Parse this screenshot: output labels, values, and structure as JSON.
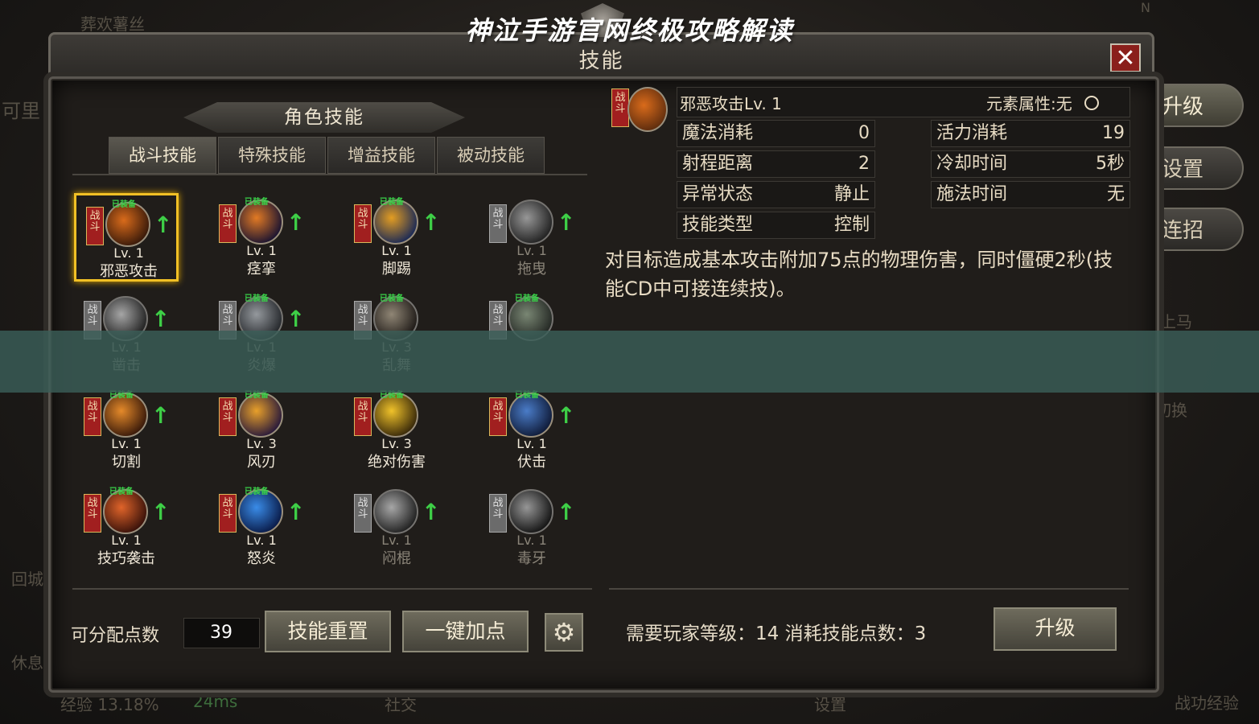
{
  "background": {
    "top_left": "葬欢薯丝",
    "left_frag": "可里",
    "left_mid_1": "回城",
    "left_mid_2": "休息",
    "bottom_left": "经验 13.18%",
    "bottom_ping": "24ms",
    "bottom_center": "社交",
    "bottom_settings": "设置",
    "bottom_right": "战功经验",
    "right_mount": "上马",
    "right_switch": "切换",
    "top_right": "N"
  },
  "side_buttons": [
    {
      "label": "升级"
    },
    {
      "label": "设置"
    },
    {
      "label": "连招"
    }
  ],
  "window": {
    "title": "技能",
    "close_icon": "✕"
  },
  "section_title": "角色技能",
  "tabs": [
    {
      "label": "战斗技能",
      "active": true
    },
    {
      "label": "特殊技能",
      "active": false
    },
    {
      "label": "增益技能",
      "active": false
    },
    {
      "label": "被动技能",
      "active": false
    }
  ],
  "flag_text": "战斗",
  "equip_text": "已装备",
  "skills": [
    {
      "level": "Lv. 1",
      "name": "邪恶攻击",
      "equipped": true,
      "upgradable": true,
      "active": true,
      "colors": [
        "#3a1a0a",
        "#d96b1b"
      ]
    },
    {
      "level": "Lv. 1",
      "name": "痉挛",
      "equipped": true,
      "upgradable": true,
      "active": true,
      "colors": [
        "#1c1430",
        "#e27a24"
      ]
    },
    {
      "level": "Lv. 1",
      "name": "脚踢",
      "equipped": true,
      "upgradable": true,
      "active": true,
      "colors": [
        "#1c2a55",
        "#e39d22"
      ]
    },
    {
      "level": "Lv. 1",
      "name": "拖曳",
      "equipped": false,
      "upgradable": true,
      "active": false,
      "colors": [
        "#2b2b2b",
        "#bdbdbd"
      ]
    },
    {
      "level": "Lv. 1",
      "name": "凿击",
      "equipped": false,
      "upgradable": true,
      "active": false,
      "colors": [
        "#2c2c2c",
        "#cfcfcf"
      ]
    },
    {
      "level": "Lv. 1",
      "name": "炎爆",
      "equipped": true,
      "upgradable": true,
      "active": false,
      "colors": [
        "#24344d",
        "#a8c2dd"
      ]
    },
    {
      "level": "Lv. 3",
      "name": "乱舞",
      "equipped": true,
      "upgradable": false,
      "active": false,
      "colors": [
        "#3b1f0c",
        "#e0a33a"
      ]
    },
    {
      "level": "",
      "name": "",
      "equipped": true,
      "upgradable": false,
      "active": false,
      "colors": [
        "#1f3a1f",
        "#6bbd45"
      ]
    },
    {
      "level": "Lv. 1",
      "name": "切割",
      "equipped": true,
      "upgradable": true,
      "active": true,
      "colors": [
        "#3a1a0a",
        "#e58a2a"
      ]
    },
    {
      "level": "Lv. 3",
      "name": "风刃",
      "equipped": true,
      "upgradable": false,
      "active": true,
      "colors": [
        "#2a1a3a",
        "#e8a02a"
      ]
    },
    {
      "level": "Lv. 3",
      "name": "绝对伤害",
      "equipped": true,
      "upgradable": false,
      "active": true,
      "colors": [
        "#3a2a0a",
        "#f0c22a"
      ]
    },
    {
      "level": "Lv. 1",
      "name": "伏击",
      "equipped": true,
      "upgradable": true,
      "active": true,
      "colors": [
        "#101c3a",
        "#4a7cc8"
      ]
    },
    {
      "level": "Lv. 1",
      "name": "技巧袭击",
      "equipped": true,
      "upgradable": true,
      "active": true,
      "colors": [
        "#3a120a",
        "#e0642a"
      ]
    },
    {
      "level": "Lv. 1",
      "name": "怒炎",
      "equipped": true,
      "upgradable": true,
      "active": true,
      "colors": [
        "#0a1c4a",
        "#3a8ce8"
      ]
    },
    {
      "level": "Lv. 1",
      "name": "闷棍",
      "equipped": false,
      "upgradable": true,
      "active": false,
      "colors": [
        "#2a2a2a",
        "#d0d0d0"
      ]
    },
    {
      "level": "Lv. 1",
      "name": "毒牙",
      "equipped": false,
      "upgradable": true,
      "active": false,
      "colors": [
        "#1a1a1a",
        "#bcbcbc"
      ]
    }
  ],
  "detail": {
    "name": "邪恶攻击Lv. 1",
    "element_label": "元素属性:无",
    "rows_left": [
      {
        "label": "魔法消耗",
        "value": "0"
      },
      {
        "label": "射程距离",
        "value": "2"
      },
      {
        "label": "异常状态",
        "value": "静止"
      },
      {
        "label": "技能类型",
        "value": "控制"
      }
    ],
    "rows_right": [
      {
        "label": "活力消耗",
        "value": "19"
      },
      {
        "label": "冷却时间",
        "value": "5秒"
      },
      {
        "label": "施法时间",
        "value": "无"
      }
    ],
    "description": "对目标造成基本攻击附加75点的物理伤害，同时僵硬2秒(技能CD中可接连续技)。"
  },
  "footer": {
    "points_label": "可分配点数",
    "points_value": "39",
    "reset_label": "技能重置",
    "auto_label": "一键加点",
    "requirement": "需要玩家等级：14 消耗技能点数：3",
    "upgrade_label": "升级"
  },
  "overlay_title": "神泣手游官网终极攻略解读",
  "colors": {
    "accent": "#f1c025",
    "overlay": "#3a5e58",
    "arrow": "#3ecf47",
    "flag": "#a11f1f"
  }
}
